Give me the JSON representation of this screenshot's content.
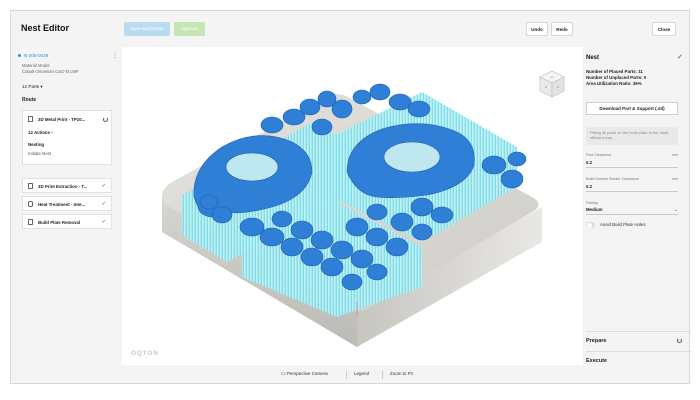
{
  "header": {
    "title": "Nest Editor",
    "save_label": "Save and Rerun",
    "approve_label": "Approve",
    "undo_label": "Undo",
    "redo_label": "Redo",
    "close_label": "Close"
  },
  "left": {
    "job_id": "N-205-0039",
    "material_label": "Material Model",
    "material_value": "Cobalt-chromium CoCr-B LMF",
    "parts": "12 Parts",
    "route_label": "Route",
    "main_card": {
      "title": "3D Metal Print - TP10...",
      "actions": "12 Actions",
      "nesting": "Nesting",
      "initiate": "Initiate Nest"
    },
    "steps": [
      {
        "title": "3D Print Extraction - T..."
      },
      {
        "title": "Heat Treatment - Inte..."
      },
      {
        "title": "Build Plate Removal"
      }
    ]
  },
  "viewport": {
    "logo": "OQTON"
  },
  "bottombar": {
    "camera": "Perspective Camera",
    "legend": "Legend",
    "zoom": "Zoom to Fit"
  },
  "right": {
    "nest_title": "Nest",
    "placed": "Number of Placed Parts: 11",
    "unplaced": "Number of Unplaced Parts: 0",
    "utilization": "Area Utilization Ratio: 35%",
    "download_label": "Download Part & Support (.stl)",
    "info_text": "Fitting all parts on the build plate in the most efficient way.",
    "part_clearance_label": "Part Clearance",
    "part_clearance_unit": "mm",
    "part_clearance_value": "0.2",
    "border_clearance_label": "Build Volume Border Clearance",
    "border_clearance_unit": "mm",
    "border_clearance_value": "0.2",
    "fidelity_label": "Fidelity",
    "fidelity_value": "Medium",
    "avoid_holes_label": "Avoid Build Plate Holes",
    "avoid_holes_enabled": false,
    "prepare_label": "Prepare",
    "execute_label": "Execute"
  },
  "colors": {
    "accent_blue": "#2a90d9",
    "part_blue": "#2f7fd6",
    "support_cyan": "#7ee3ee",
    "success_green": "#3fae2a"
  }
}
